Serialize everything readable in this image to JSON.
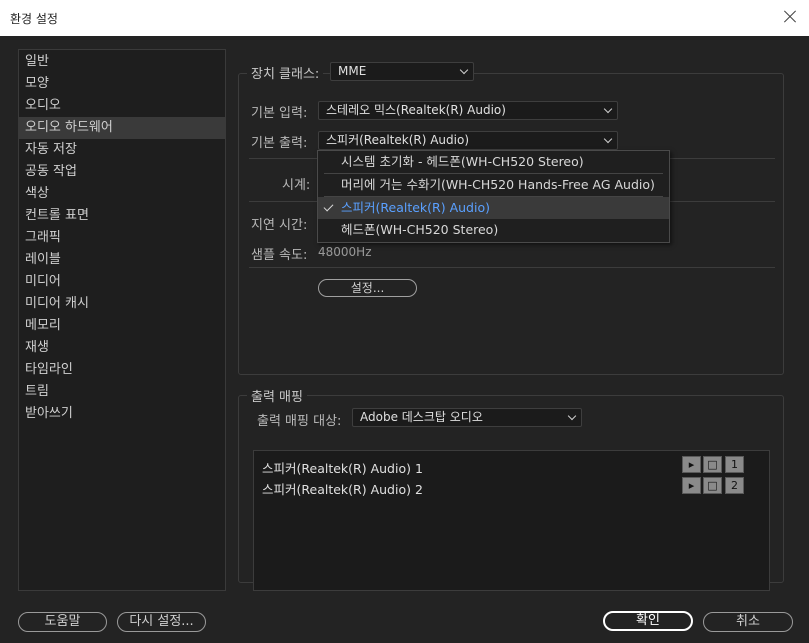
{
  "window": {
    "title": "환경 설정"
  },
  "sidebar": {
    "items": [
      {
        "label": "일반"
      },
      {
        "label": "모양"
      },
      {
        "label": "오디오"
      },
      {
        "label": "오디오 하드웨어"
      },
      {
        "label": "자동 저장"
      },
      {
        "label": "공동 작업"
      },
      {
        "label": "색상"
      },
      {
        "label": "컨트롤 표면"
      },
      {
        "label": "그래픽"
      },
      {
        "label": "레이블"
      },
      {
        "label": "미디어"
      },
      {
        "label": "미디어 캐시"
      },
      {
        "label": "메모리"
      },
      {
        "label": "재생"
      },
      {
        "label": "타임라인"
      },
      {
        "label": "트림"
      },
      {
        "label": "받아쓰기"
      }
    ],
    "selected_index": 3
  },
  "device": {
    "class_label": "장치 클래스:",
    "class_value": "MME",
    "input_label": "기본 입력:",
    "input_value": "스테레오 믹스(Realtek(R) Audio)",
    "output_label": "기본 출력:",
    "output_value": "스피커(Realtek(R) Audio)",
    "clock_label": "시계:",
    "latency_label": "지연 시간:",
    "sample_rate_label": "샘플 속도:",
    "sample_rate_value": "48000Hz",
    "settings_button": "설정..."
  },
  "output_popup": {
    "options": [
      "시스템 초기화 - 헤드폰(WH-CH520 Stereo)",
      "머리에 거는 수화기(WH-CH520 Hands-Free AG Audio)",
      "스피커(Realtek(R) Audio)",
      "헤드폰(WH-CH520 Stereo)"
    ],
    "selected_index": 2
  },
  "mapping": {
    "section_title": "출력 매핑",
    "target_label": "출력 매핑 대상:",
    "target_value": "Adobe 데스크탑 오디오",
    "channels": [
      {
        "name": "스피커(Realtek(R) Audio) 1",
        "number": "1"
      },
      {
        "name": "스피커(Realtek(R) Audio) 2",
        "number": "2"
      }
    ]
  },
  "footer": {
    "help": "도움말",
    "reset": "다시 설정...",
    "ok": "확인",
    "cancel": "취소"
  },
  "colors": {
    "background": "#232323",
    "selected_text": "#5aa0ff"
  }
}
